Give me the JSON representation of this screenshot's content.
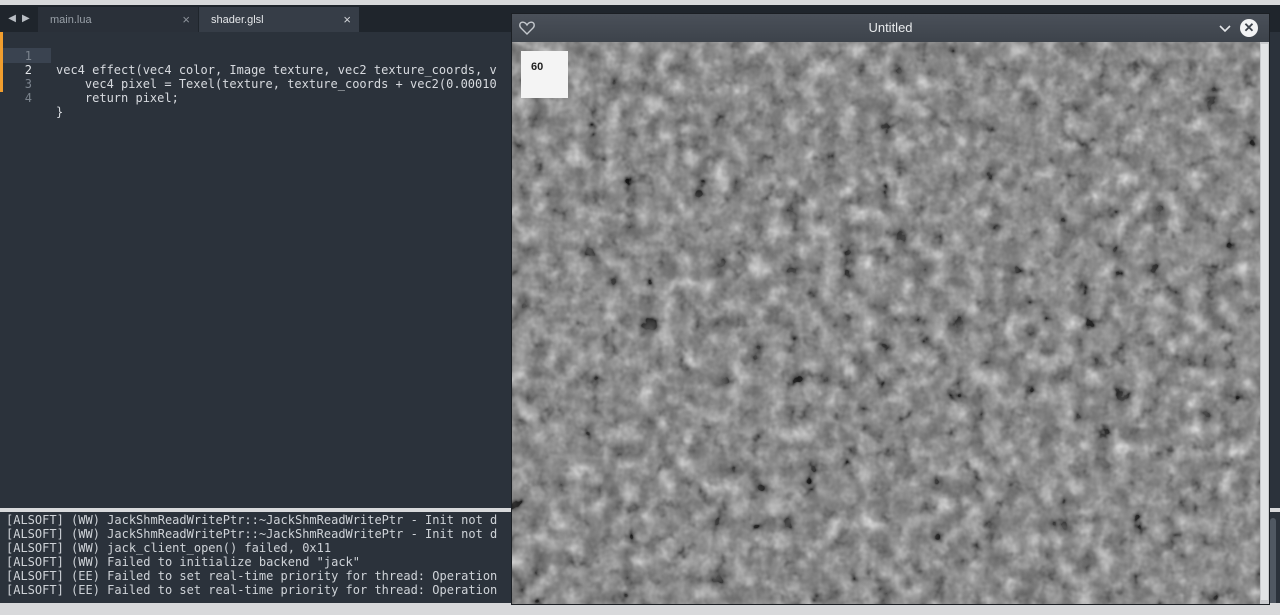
{
  "editor": {
    "tabs": [
      {
        "label": "main.lua",
        "active": false
      },
      {
        "label": "shader.glsl",
        "active": true
      }
    ],
    "close_glyph": "×",
    "lines": [
      {
        "number": "1",
        "text": "vec4 effect(vec4 color, Image texture, vec2 texture_coords, v"
      },
      {
        "number": "2",
        "text": "    vec4 pixel = Texel(texture, texture_coords + vec2(0.00010"
      },
      {
        "number": "3",
        "text": "    return pixel;"
      },
      {
        "number": "4",
        "text": "}"
      }
    ],
    "current_line": 2,
    "accent_color": "#f19e2e"
  },
  "console": {
    "lines": [
      "[ALSOFT] (WW) JackShmReadWritePtr::~JackShmReadWritePtr - Init not d",
      "[ALSOFT] (WW) JackShmReadWritePtr::~JackShmReadWritePtr - Init not d",
      "[ALSOFT] (WW) jack_client_open() failed, 0x11",
      "[ALSOFT] (WW) Failed to initialize backend \"jack\"",
      "[ALSOFT] (EE) Failed to set real-time priority for thread: Operation",
      "[ALSOFT] (EE) Failed to set real-time priority for thread: Operation"
    ]
  },
  "game_window": {
    "title": "Untitled",
    "fps": "60",
    "icons": [
      "heart-icon",
      "chevron-down-icon",
      "close-icon"
    ]
  }
}
